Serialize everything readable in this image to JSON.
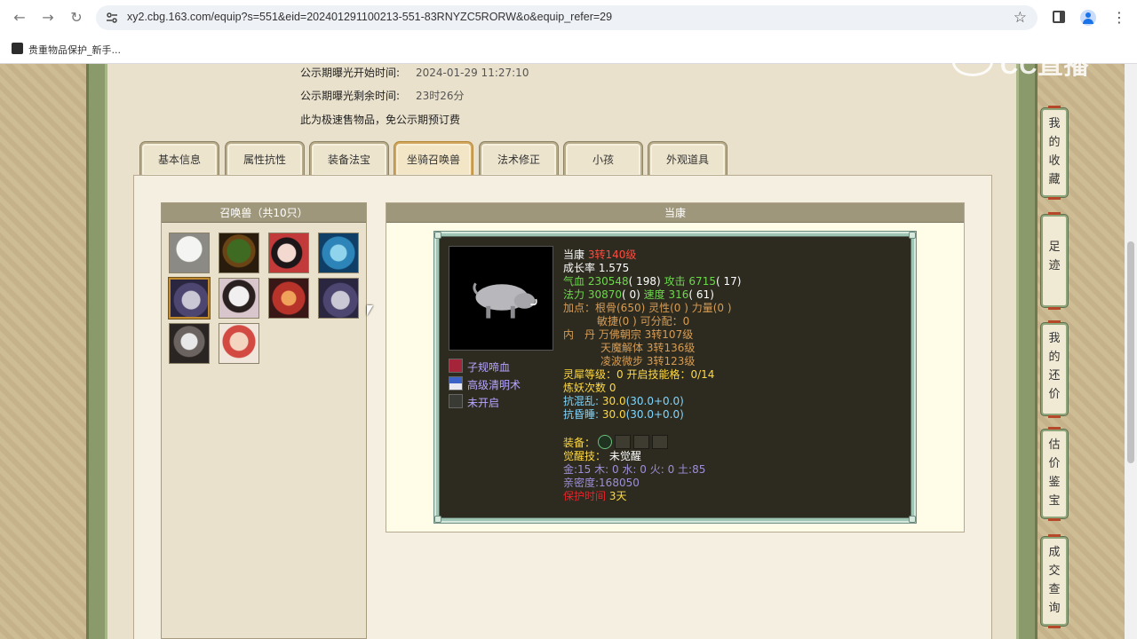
{
  "browser": {
    "url": "xy2.cbg.163.com/equip?s=551&eid=202401291100213-551-83RNYZC5RORW&o&equip_refer=29",
    "bookmark": "贵重物品保护_新手..."
  },
  "watermark": "CC直播",
  "notice": {
    "start_label": "公示期曝光开始时间:",
    "start_value": "2024-01-29 11:27:10",
    "remain_label": "公示期曝光剩余时间:",
    "remain_value": "23时26分",
    "fast_sale": "此为极速售物品，免公示期预订费"
  },
  "tabs": [
    "基本信息",
    "属性抗性",
    "装备法宝",
    "坐骑召唤兽",
    "法术修正",
    "小孩",
    "外观道具"
  ],
  "active_tab": 3,
  "pet_list": {
    "header": "召唤兽（共10只）",
    "selected_index": 4
  },
  "detail": {
    "header": "当康",
    "name": "当康",
    "level": "3转140级",
    "growth_label": "成长率",
    "growth": "1.575",
    "hp_label": "气血",
    "hp": "230548",
    "hp_pts": "( 198)",
    "atk_label": "攻击",
    "atk": "6715",
    "atk_pts": "( 17)",
    "mp_label": "法力",
    "mp": "30870",
    "mp_pts": "( 0)",
    "spd_label": "速度",
    "spd": "316",
    "spd_pts": "( 61)",
    "addpts_line1": "加点：根骨(650) 灵性(0 ) 力量(0 )",
    "addpts_line2": "敏捷(0 ) 可分配：0",
    "neidan_label": "内　丹",
    "neidan": [
      "万佛朝宗 3转107级",
      "天魔解体 3转136级",
      "凌波微步 3转123级"
    ],
    "lingxi_label": "灵犀等级：",
    "lingxi_value": "0 开启技能格：0/14",
    "lianyao": "炼妖次数 0",
    "kanghunluan_label": "抗混乱:",
    "kanghunluan_value": "30.0",
    "kanghunluan_detail": "(30.0+0.0)",
    "kanghunshui_label": "抗昏睡:",
    "kanghunshui_value": "30.0",
    "kanghunshui_detail": "(30.0+0.0)",
    "equip_label": "装备：",
    "awaken_label": "觉醒技：",
    "awaken_value": "未觉醒",
    "elements": "金:15 木: 0 水: 0 火: 0 土:85",
    "intimacy": "亲密度:168050",
    "protect_label": "保护时间",
    "protect_value": "3天",
    "skills": [
      "子规啼血",
      "高级清明术",
      "未开启"
    ]
  },
  "side_nav": [
    [
      "我",
      "的",
      "收",
      "藏"
    ],
    [
      "足",
      "迹"
    ],
    [
      "我",
      "的",
      "还",
      "价"
    ],
    [
      "估",
      "价",
      "鉴",
      "宝"
    ],
    [
      "成",
      "交",
      "查",
      "询"
    ]
  ]
}
